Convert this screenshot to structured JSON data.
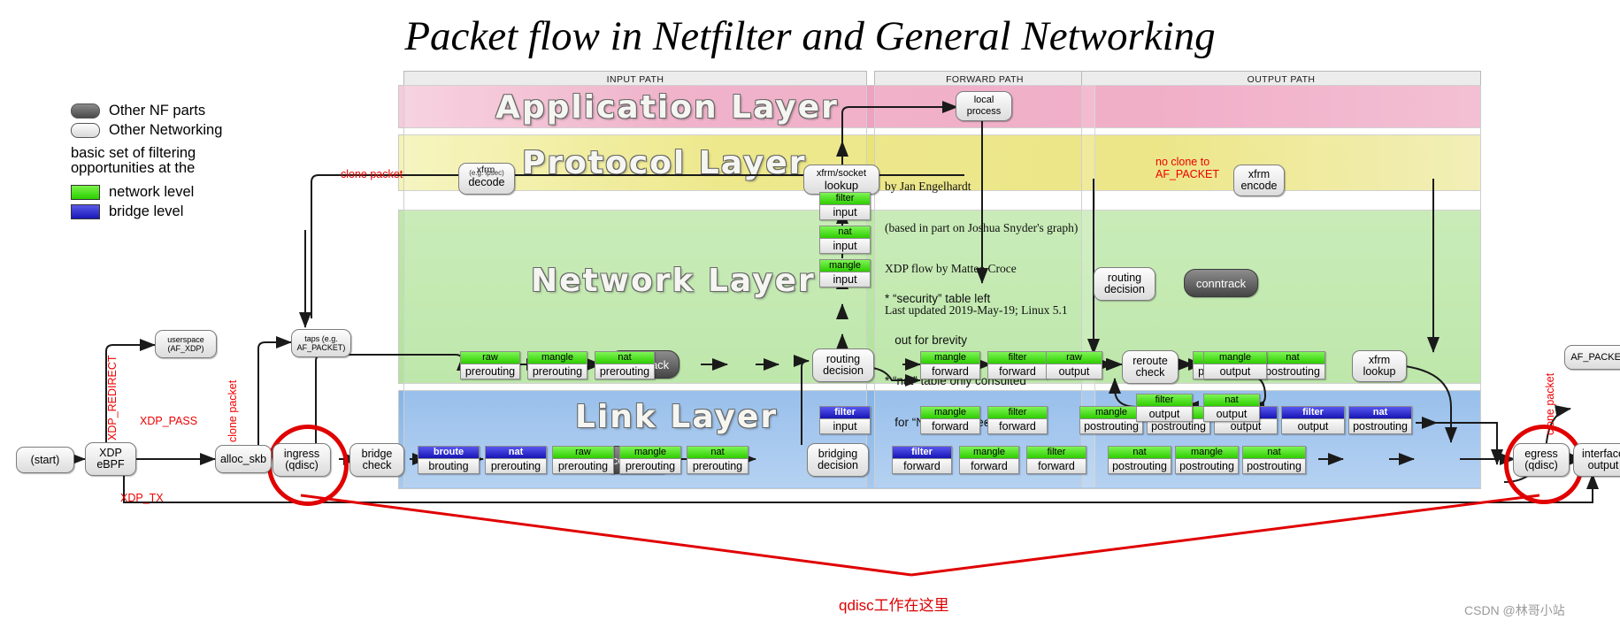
{
  "title": "Packet flow in Netfilter and General Networking",
  "legend": {
    "items": [
      {
        "label": "Other NF parts",
        "swatch": "pill-dark",
        "color": "#4a4a4a"
      },
      {
        "label": "Other Networking",
        "swatch": "pill-light",
        "color": "#d8d8d8"
      }
    ],
    "note_line1": "basic set of filtering",
    "note_line2": "opportunities at the",
    "levels": [
      {
        "label": "network level",
        "color": "#2bd000"
      },
      {
        "label": "bridge level",
        "color": "#1a18b8"
      }
    ]
  },
  "paths": {
    "input": "INPUT PATH",
    "forward": "FORWARD PATH",
    "output": "OUTPUT PATH"
  },
  "layers": {
    "application": "Application Layer",
    "protocol": "Protocol Layer",
    "network": "Network Layer",
    "link": "Link Layer"
  },
  "credit": {
    "line1": "by Jan Engelhardt",
    "line2": "(based in part on Joshua Snyder's graph)",
    "line3": "XDP flow by Matteo Croce",
    "line4": "Last updated 2019-May-19; Linux 5.1"
  },
  "notes": {
    "security_1": "* “security” table left",
    "security_2": "   out for brevity",
    "nat_1": "* “nat” table only consulted",
    "nat_2": "   for “NEW” connections"
  },
  "red_labels": {
    "clone_packet_left": "clone packet",
    "clone_packet_tap": "clone packet",
    "clone_packet_right": "clone packet",
    "xdp_redirect": "XDP_REDIRECT",
    "xdp_pass": "XDP_PASS",
    "xdp_tx": "XDP_TX",
    "no_clone_1": "no clone to",
    "no_clone_2": "AF_PACKET"
  },
  "bottom_annotation": "qdisc工作在这里",
  "watermark": "CSDN @林哥小站",
  "pills": {
    "start": {
      "l1": "(start)",
      "l2": ""
    },
    "xdp_ebpf": {
      "l1": "XDP",
      "l2": "eBPF"
    },
    "userspace_afxdp": {
      "l1": "userspace",
      "l2": "(AF_XDP)"
    },
    "alloc_skb": {
      "l1": "alloc_skb",
      "l2": ""
    },
    "taps": {
      "l1": "taps (e.g.",
      "l2": "AF_PACKET)"
    },
    "ingress_qdisc": {
      "l1": "ingress",
      "l2": "(qdisc)"
    },
    "bridge_check": {
      "l1": "bridge",
      "l2": "check"
    },
    "bridging_decision": {
      "l1": "bridging",
      "l2": "decision"
    },
    "routing_decision_in": {
      "l1": "routing",
      "l2": "decision"
    },
    "xfrm_decode": {
      "l1": "xfrm",
      "l2": "decode",
      "sub": "(e.g. ipsec)"
    },
    "xfrm_socket_lookup": {
      "l1": "xfrm/socket",
      "l2": "lookup"
    },
    "local_process": {
      "l1": "local",
      "l2": "process"
    },
    "routing_decision_out": {
      "l1": "routing",
      "l2": "decision"
    },
    "conntrack": {
      "l1": "conntrack",
      "l2": ""
    },
    "reroute_check": {
      "l1": "reroute",
      "l2": "check"
    },
    "xfrm_encode": {
      "l1": "xfrm",
      "l2": "encode"
    },
    "xfrm_lookup": {
      "l1": "xfrm",
      "l2": "lookup"
    },
    "egress_qdisc": {
      "l1": "egress",
      "l2": "(qdisc)"
    },
    "interface_output": {
      "l1": "interface",
      "l2": "output"
    },
    "af_packet": {
      "l1": "AF_PACKET",
      "l2": ""
    }
  },
  "chain_nodes": {
    "link_prerouting": [
      {
        "table": "broute",
        "chain": "brouting",
        "level": "bridge"
      },
      {
        "table": "nat",
        "chain": "prerouting",
        "level": "bridge"
      },
      {
        "table": "raw",
        "chain": "prerouting",
        "level": "network"
      },
      {
        "table": "mangle",
        "chain": "prerouting",
        "level": "network"
      },
      {
        "table": "nat",
        "chain": "prerouting",
        "level": "network"
      }
    ],
    "net_prerouting": [
      {
        "table": "raw",
        "chain": "prerouting",
        "level": "network"
      },
      {
        "table": "mangle",
        "chain": "prerouting",
        "level": "network"
      },
      {
        "table": "nat",
        "chain": "prerouting",
        "level": "network"
      }
    ],
    "net_input": [
      {
        "table": "mangle",
        "chain": "input",
        "level": "network"
      },
      {
        "table": "nat",
        "chain": "input",
        "level": "network"
      },
      {
        "table": "filter",
        "chain": "input",
        "level": "network"
      }
    ],
    "link_input": [
      {
        "table": "filter",
        "chain": "input",
        "level": "bridge"
      }
    ],
    "net_forward": [
      {
        "table": "mangle",
        "chain": "forward",
        "level": "network"
      },
      {
        "table": "filter",
        "chain": "forward",
        "level": "network"
      }
    ],
    "link_forward_top": [
      {
        "table": "mangle",
        "chain": "forward",
        "level": "network"
      },
      {
        "table": "filter",
        "chain": "forward",
        "level": "network"
      }
    ],
    "link_forward_bottom": [
      {
        "table": "filter",
        "chain": "forward",
        "level": "bridge"
      },
      {
        "table": "mangle",
        "chain": "forward",
        "level": "network"
      },
      {
        "table": "filter",
        "chain": "forward",
        "level": "network"
      }
    ],
    "net_output": [
      {
        "table": "raw",
        "chain": "output",
        "level": "network"
      },
      {
        "table": "mangle",
        "chain": "output",
        "level": "network"
      },
      {
        "table": "filter",
        "chain": "output",
        "level": "network"
      },
      {
        "table": "nat",
        "chain": "output",
        "level": "network"
      }
    ],
    "net_postrouting": [
      {
        "table": "mangle",
        "chain": "postrouting",
        "level": "network"
      },
      {
        "table": "nat",
        "chain": "postrouting",
        "level": "network"
      }
    ],
    "link_postrouting_top": [
      {
        "table": "mangle",
        "chain": "postrouting",
        "level": "network"
      },
      {
        "table": "nat",
        "chain": "postrouting",
        "level": "network"
      },
      {
        "table": "nat",
        "chain": "output",
        "level": "bridge"
      },
      {
        "table": "filter",
        "chain": "output",
        "level": "bridge"
      },
      {
        "table": "nat",
        "chain": "postrouting",
        "level": "bridge"
      }
    ],
    "link_postrouting_bottom": [
      {
        "table": "nat",
        "chain": "postrouting",
        "level": "network"
      },
      {
        "table": "mangle",
        "chain": "postrouting",
        "level": "network"
      },
      {
        "table": "nat",
        "chain": "postrouting",
        "level": "network"
      }
    ]
  },
  "colors": {
    "network_level": "#2bd000",
    "bridge_level": "#1a18b8",
    "application_layer": "#ef9fbd",
    "protocol_layer": "#e9e272",
    "network_layer": "#b2e39c",
    "link_layer": "#85b4e8",
    "highlight": "#e00000"
  }
}
